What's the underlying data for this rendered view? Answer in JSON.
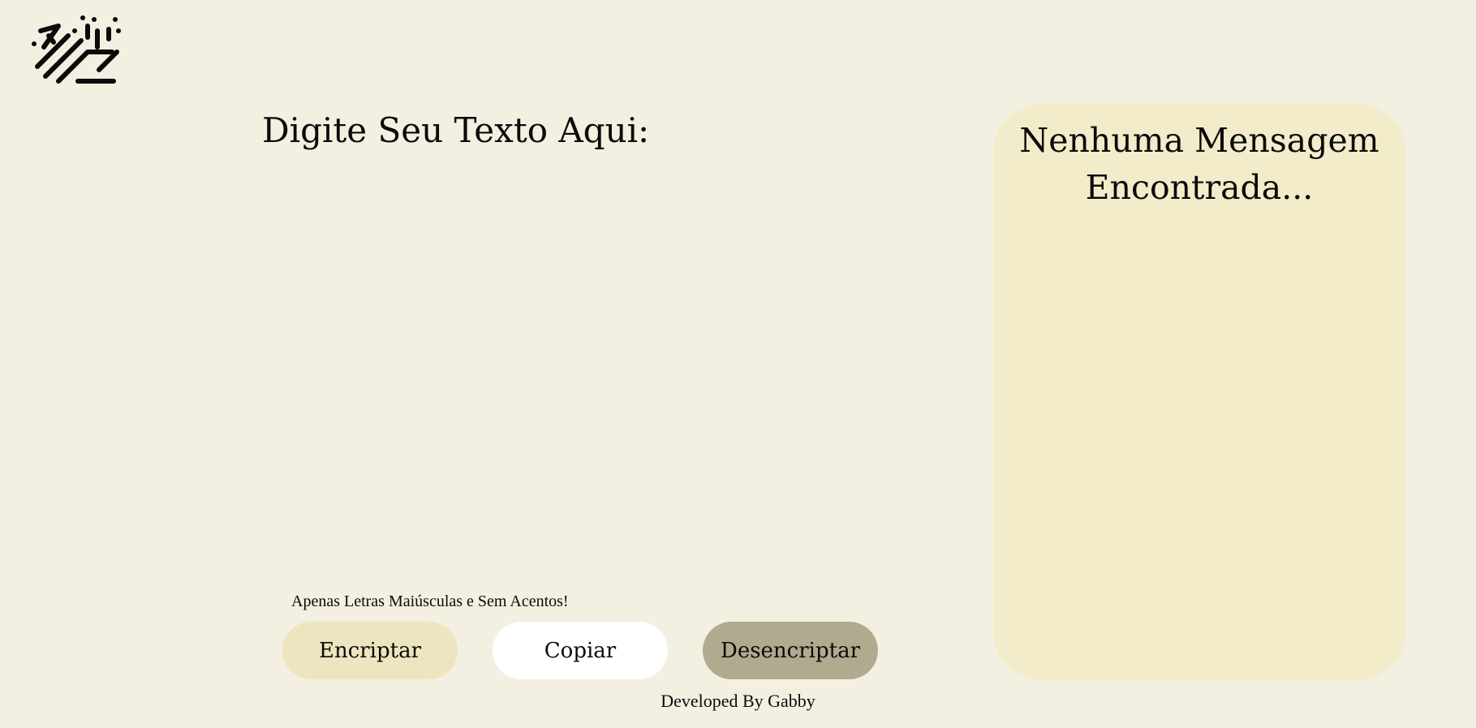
{
  "input": {
    "title": "Digite Seu Texto Aqui:",
    "value": "",
    "hint": "Apenas Letras Maiúsculas e Sem Acentos!"
  },
  "buttons": {
    "encrypt_label": "Encriptar",
    "copy_label": "Copiar",
    "decrypt_label": "Desencriptar"
  },
  "output": {
    "message": "Nenhuma Mensagem Encontrada..."
  },
  "footer": {
    "text": "Developed By Gabby"
  },
  "colors": {
    "background": "#f3efe1",
    "panel": "#f2ecca",
    "encrypt_button": "#ede5bf",
    "copy_button": "#ffffff",
    "decrypt_button": "#b0aa8f",
    "text": "#0b0b0b"
  },
  "icons": {
    "logo": "alura-logo-icon"
  }
}
